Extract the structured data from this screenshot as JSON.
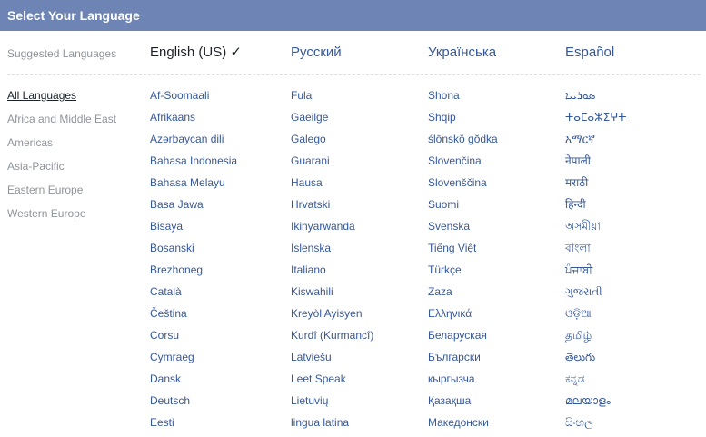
{
  "header": {
    "title": "Select Your Language"
  },
  "suggested": {
    "label": "Suggested Languages",
    "items": [
      {
        "label": "English (US) ✓",
        "current": true
      },
      {
        "label": "Русский",
        "current": false
      },
      {
        "label": "Українська",
        "current": false
      },
      {
        "label": "Español",
        "current": false
      }
    ]
  },
  "regions": {
    "items": [
      {
        "label": "All Languages",
        "active": true
      },
      {
        "label": "Africa and Middle East",
        "active": false
      },
      {
        "label": "Americas",
        "active": false
      },
      {
        "label": "Asia-Pacific",
        "active": false
      },
      {
        "label": "Eastern Europe",
        "active": false
      },
      {
        "label": "Western Europe",
        "active": false
      }
    ]
  },
  "languages": {
    "columns": [
      [
        "Af-Soomaali",
        "Afrikaans",
        "Azərbaycan dili",
        "Bahasa Indonesia",
        "Bahasa Melayu",
        "Basa Jawa",
        "Bisaya",
        "Bosanski",
        "Brezhoneg",
        "Català",
        "Čeština",
        "Corsu",
        "Cymraeg",
        "Dansk",
        "Deutsch",
        "Eesti"
      ],
      [
        "Fula",
        "Gaeilge",
        "Galego",
        "Guarani",
        "Hausa",
        "Hrvatski",
        "Ikinyarwanda",
        "Íslenska",
        "Italiano",
        "Kiswahili",
        "Kreyòl Ayisyen",
        "Kurdî (Kurmancî)",
        "Latviešu",
        "Leet Speak",
        "Lietuvių",
        "lingua latina"
      ],
      [
        "Shona",
        "Shqip",
        "ślōnskŏ gŏdka",
        "Slovenčina",
        "Slovenščina",
        "Suomi",
        "Svenska",
        "Tiếng Việt",
        "Türkçe",
        "Zaza",
        "Ελληνικά",
        "Беларуская",
        "Български",
        "кыргызча",
        "Қазақша",
        "Македонски"
      ],
      [
        "ܣܘܪܝܝܐ",
        "ⵜⴰⵎⴰⵣⵉⵖⵜ",
        "አማርኛ",
        "नेपाली",
        "मराठी",
        "हिन्दी",
        "অসমীয়া",
        "বাংলা",
        "ਪੰਜਾਬੀ",
        "ગુજરાતી",
        "ଓଡ଼ିଆ",
        "தமிழ்",
        "తెలుగు",
        "ಕನ್ನಡ",
        "മലയാളം",
        "සිංහල"
      ]
    ]
  }
}
